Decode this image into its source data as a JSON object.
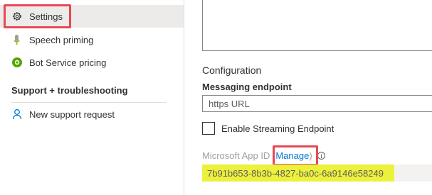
{
  "sidebar": {
    "items": [
      {
        "label": "Settings",
        "icon": "gear-icon",
        "selected": true
      },
      {
        "label": "Speech priming",
        "icon": "microphone-icon"
      },
      {
        "label": "Bot Service pricing",
        "icon": "pricing-icon"
      }
    ],
    "support_header": "Support + troubleshooting",
    "support_items": [
      {
        "label": "New support request",
        "icon": "person-support-icon"
      }
    ]
  },
  "main": {
    "configuration_title": "Configuration",
    "messaging_endpoint_label": "Messaging endpoint",
    "messaging_endpoint_placeholder": "https URL",
    "streaming_checkbox_label": "Enable Streaming Endpoint",
    "streaming_checked": false,
    "app_id_label": "Microsoft App ID",
    "app_id_open_paren": "(",
    "manage_link": "Manage",
    "app_id_close_paren": ")",
    "app_id_value": "7b91b653-8b3b-4827-ba0c-6a9146e58249"
  },
  "colors": {
    "annotation_red": "#e74856",
    "highlight_yellow": "#ecf13c",
    "link_blue": "#0078d4",
    "selected_bg": "#edebe9"
  }
}
